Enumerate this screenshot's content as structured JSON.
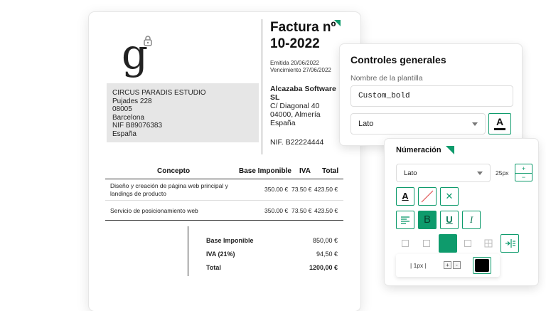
{
  "invoice": {
    "title_line1": "Factura nº",
    "title_line2": "10-2022",
    "issued": "Emitida 20/06/2022",
    "due": "Vencimiento 27/06/2022",
    "client": {
      "name": "CIRCUS PARADIS ESTUDIO",
      "street": "Pujades 228",
      "zip": "08005",
      "city": "Barcelona",
      "nif": "NIF B89076383",
      "country": "España"
    },
    "issuer": {
      "name_line1": "Alcazaba Software",
      "name_line2": "SL",
      "street": "C/ Diagonal 40",
      "zip_city": "04000, Almería",
      "country": "España",
      "nif": "NIF. B22224444"
    },
    "table": {
      "headers": [
        "Concepto",
        "Base Imponible",
        "IVA",
        "Total"
      ],
      "rows": [
        {
          "concept_line1": "Diseño y creación de página web principal y",
          "concept_line2": "landings de producto",
          "base": "350.00 €",
          "iva": "73.50 €",
          "total": "423.50 €"
        },
        {
          "concept_line1": "Servicio de posicionamiento web",
          "concept_line2": "",
          "base": "350.00 €",
          "iva": "73.50 €",
          "total": "423.50 €"
        }
      ]
    },
    "totals": {
      "base_label": "Base Imponible",
      "base_value": "850,00 €",
      "iva_label": "IVA (21%)",
      "iva_value": "94,50 €",
      "total_label": "Total",
      "total_value": "1200,00 €"
    }
  },
  "general_controls": {
    "title": "Controles generales",
    "template_label": "Nombre de la plantilla",
    "template_value": "Custom_bold",
    "font_value": "Lato",
    "color_button_glyph": "A"
  },
  "numbering": {
    "title": "Númeración",
    "font_value": "Lato",
    "size_value": "25px",
    "step_up": "+",
    "step_down": "−",
    "color_glyph": "A",
    "clear_glyph": "✕",
    "bold_glyph": "B",
    "underline_glyph": "U",
    "italic_glyph": "I",
    "border_width": "| 1px |",
    "plus": "+",
    "minus": "-"
  },
  "colors": {
    "accent": "#0e9b6c",
    "swatch": "#000000"
  },
  "icons": [
    "padlock-icon",
    "corner-flag-icon",
    "chevron-down-icon",
    "text-color-icon",
    "no-fill-icon",
    "close-icon",
    "align-left-icon",
    "bold-icon",
    "underline-icon",
    "italic-icon",
    "border-icon",
    "align-right-icon"
  ]
}
